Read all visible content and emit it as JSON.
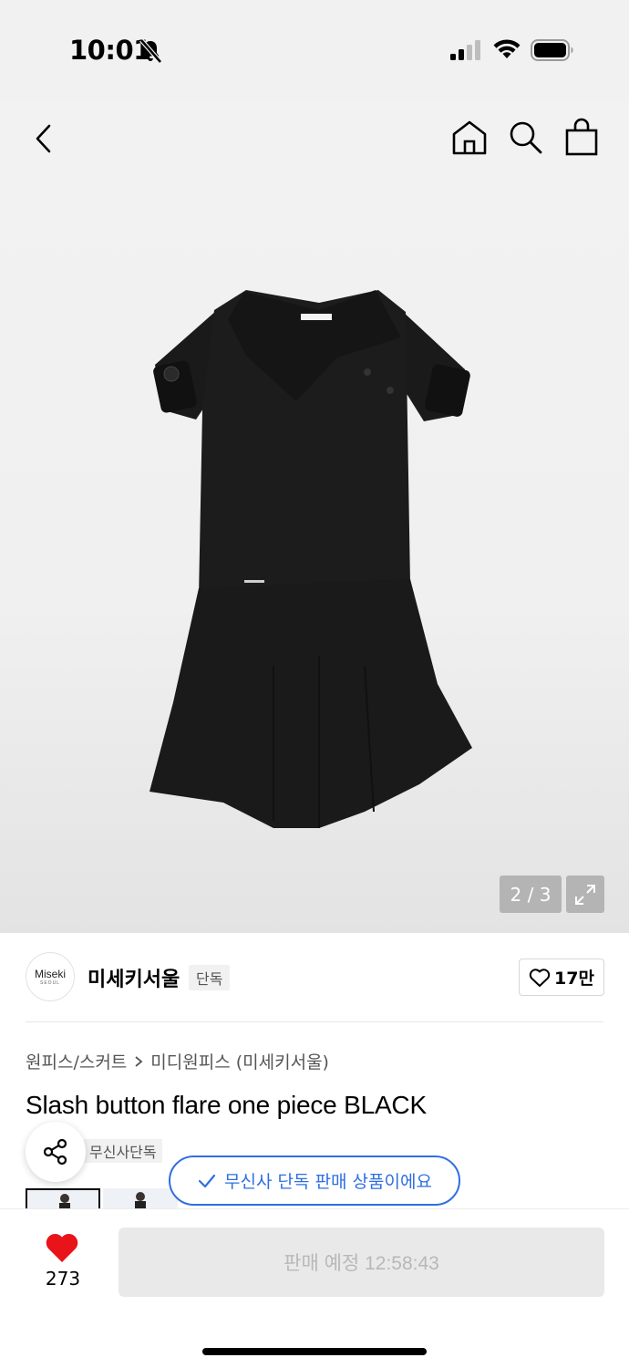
{
  "status_bar": {
    "time": "10:01"
  },
  "gallery": {
    "page_indicator": "2 / 3"
  },
  "brand": {
    "logo_text": "Miseki",
    "logo_sub": "SEOUL",
    "name": "미세키서울",
    "tag": "단독",
    "like_count": "17만"
  },
  "product": {
    "breadcrumb_category": "원피스/스커트",
    "breadcrumb_subcategory": "미디원피스 (미세키서울)",
    "title": "Slash button flare one piece BLACK",
    "exclusive_tag": "무신사단독"
  },
  "toast": {
    "message": "무신사 단독 판매 상품이에요"
  },
  "bottom_bar": {
    "wish_count": "273",
    "buy_label": "판매 예정 12:58:43"
  },
  "colors": {
    "accent_blue": "#2f6fe0",
    "heart_red": "#e8141a"
  }
}
